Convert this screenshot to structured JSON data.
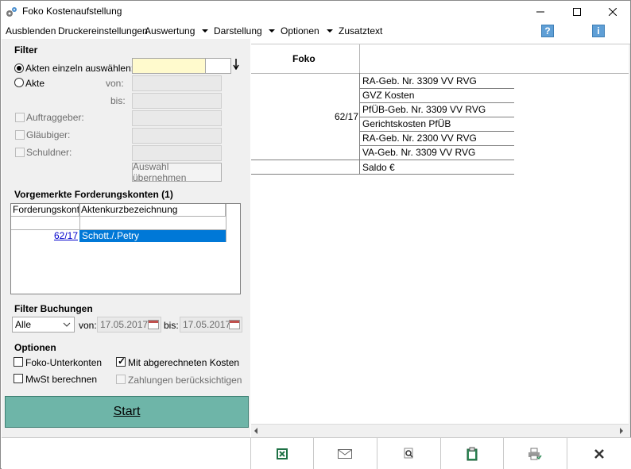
{
  "window": {
    "title": "Foko Kostenaufstellung"
  },
  "menu": {
    "items": [
      "Ausblenden",
      "Druckereinstellungen",
      "Auswertung",
      "Darstellung",
      "Optionen",
      "Zusatztext"
    ]
  },
  "filter": {
    "title": "Filter",
    "akteEinzeln": {
      "label": "Akten einzeln auswählen:",
      "selected": true,
      "value": ""
    },
    "akte": {
      "label": "Akte",
      "selected": false
    },
    "von_label": "von:",
    "bis_label": "bis:",
    "auftraggeber": "Auftraggeber:",
    "glaeubiger": "Gläubiger:",
    "schuldner": "Schuldner:",
    "auswahl_button": "Auswahl übernehmen"
  },
  "vorgemerkt": {
    "title": "Vorgemerkte Forderungskonten (1)",
    "columns": [
      "Forderungskonto",
      "Aktenkurzbezeichnung"
    ],
    "rows": [
      {
        "konto": "62/17",
        "bezeichnung": "Schott./.Petry",
        "selected": true
      }
    ]
  },
  "buchungen": {
    "title": "Filter Buchungen",
    "type_value": "Alle",
    "von_label": "von:",
    "von_value": "17.05.2017",
    "bis_label": "bis:",
    "bis_value": "17.05.2017"
  },
  "optionen": {
    "title": "Optionen",
    "foko_unterkonten": {
      "label": "Foko-Unterkonten",
      "checked": false
    },
    "mwst": {
      "label": "MwSt berechnen",
      "checked": false
    },
    "abgerechnete_kosten": {
      "label": "Mit abgerechneten Kosten",
      "checked": true
    },
    "zahlungen": {
      "label": "Zahlungen berücksichtigen",
      "checked": false,
      "disabled": true
    }
  },
  "start_label": "Start",
  "report": {
    "header": "Foko",
    "fokoKey": "62/17",
    "items": [
      "RA-Geb. Nr. 3309 VV RVG",
      "GVZ Kosten",
      "PfÜB-Geb. Nr. 3309 VV RVG",
      "Gerichtskosten PfÜB",
      "RA-Geb. Nr. 2300 VV RVG",
      "VA-Geb. Nr. 3309 VV RVG"
    ],
    "saldo": "Saldo  €"
  },
  "toolbar": {
    "buttons": [
      "excel-icon",
      "mail-icon",
      "preview-icon",
      "clipboard-icon",
      "print-icon",
      "close-icon"
    ]
  },
  "colors": {
    "start_button": "#6eb5a8",
    "selection": "#0078d7",
    "help": "#5f9fd6",
    "input_highlight": "#fffacd"
  }
}
